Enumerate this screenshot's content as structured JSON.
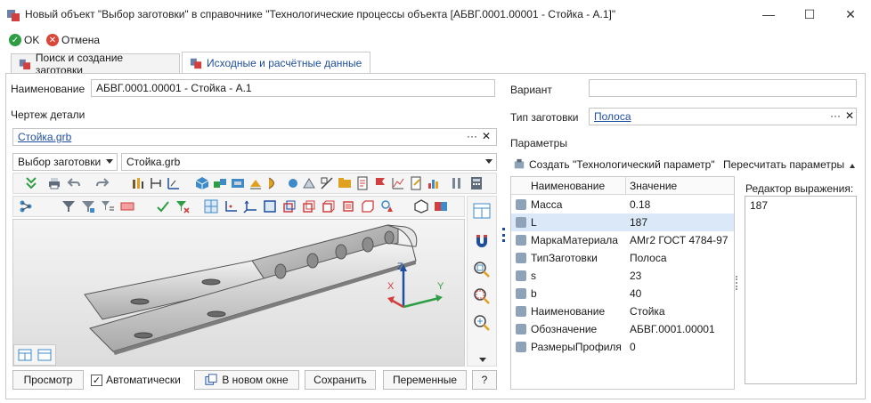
{
  "window": {
    "title": "Новый объект \"Выбор заготовки\" в справочнике \"Технологические процессы объекта [АБВГ.0001.00001 - Стойка - А.1]\"",
    "minimize": "—",
    "maximize": "☐",
    "close": "✕"
  },
  "commands": {
    "ok": "OK",
    "cancel": "Отмена"
  },
  "tabs": [
    {
      "label": "Поиск и создание заготовки"
    },
    {
      "label": "Исходные и расчётные данные"
    }
  ],
  "left": {
    "name_label": "Наименование",
    "name_value": "АБВГ.0001.00001 - Стойка - А.1",
    "drawing_label": "Чертеж детали",
    "drawing_file": "Стойка.grb",
    "selector_combo": "Выбор заготовки",
    "file_combo": "Стойка.grb",
    "axis_x": "X",
    "axis_y": "Y",
    "axis_z": "Z",
    "buttons": {
      "preview": "Просмотр",
      "auto": "Автоматически",
      "new_window": "В новом окне",
      "save": "Сохранить",
      "variables": "Переменные",
      "help": "?"
    },
    "auto_checked": true
  },
  "right": {
    "variant_label": "Вариант",
    "variant_value": "",
    "blank_type_label": "Тип заготовки",
    "blank_type_value": "Полоса",
    "params_label": "Параметры",
    "create_param": "Создать \"Технологический параметр\"",
    "recalc": "Пересчитать параметры",
    "columns": {
      "name": "Наименование",
      "value": "Значение"
    },
    "rows": [
      {
        "name": "Масса",
        "value": "0.18"
      },
      {
        "name": "L",
        "value": "187"
      },
      {
        "name": "МаркаМатериала",
        "value": "АМг2 ГОСТ 4784-97"
      },
      {
        "name": "ТипЗаготовки",
        "value": "Полоса"
      },
      {
        "name": "s",
        "value": "23"
      },
      {
        "name": "b",
        "value": "40"
      },
      {
        "name": "Наименование",
        "value": "Стойка"
      },
      {
        "name": "Обозначение",
        "value": "АБВГ.0001.00001"
      },
      {
        "name": "РазмерыПрофиля",
        "value": "0"
      }
    ],
    "selected_row": 1,
    "editor_label": "Редактор выражения:",
    "editor_value": "187"
  },
  "colors": {
    "accent": "#1f4e9e",
    "ok": "#2e9e44",
    "cancel": "#d9473b",
    "selection": "#dbe8f7"
  }
}
